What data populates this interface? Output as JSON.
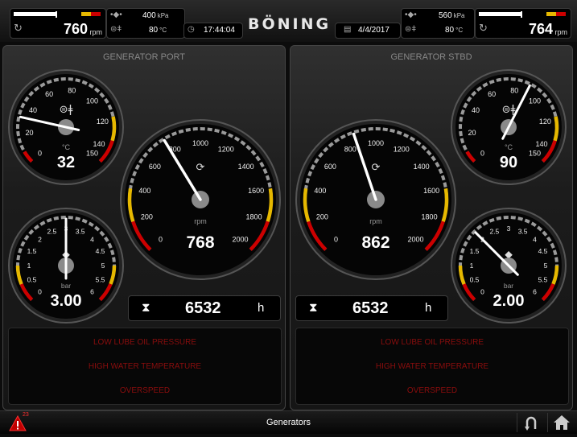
{
  "topbar": {
    "port": {
      "rpm_value": "760",
      "rpm_unit": "rpm",
      "pressure_value": "400",
      "pressure_unit": "kPa",
      "temp_value": "80",
      "temp_unit": "°C"
    },
    "time": "17:44:04",
    "logo": "BÖNING",
    "date": "4/4/2017",
    "stbd": {
      "rpm_value": "764",
      "rpm_unit": "rpm",
      "pressure_value": "560",
      "pressure_unit": "kPa",
      "temp_value": "80",
      "temp_unit": "°C"
    }
  },
  "panels": [
    {
      "title": "GENERATOR PORT",
      "temp_gauge": {
        "labels": [
          "0",
          "20",
          "40",
          "60",
          "80",
          "100",
          "120",
          "140",
          "150"
        ],
        "unit": "°C",
        "value": "32",
        "reading": 32
      },
      "pressure_gauge": {
        "labels": [
          "0",
          "0.5",
          "1",
          "1.5",
          "2",
          "2.5",
          "3",
          "3.5",
          "4",
          "4.5",
          "5",
          "5.5",
          "6"
        ],
        "unit": "bar",
        "value": "3.00",
        "reading": 3.0
      },
      "rpm_gauge": {
        "labels": [
          "0",
          "200",
          "400",
          "600",
          "800",
          "1000",
          "1200",
          "1400",
          "1600",
          "1800",
          "2000"
        ],
        "unit": "rpm",
        "value": "768",
        "reading": 768
      },
      "hours": {
        "value": "6532",
        "unit": "h"
      },
      "alarms": [
        "LOW LUBE OIL PRESSURE",
        "HIGH WATER TEMPERATURE",
        "OVERSPEED"
      ]
    },
    {
      "title": "GENERATOR STBD",
      "temp_gauge": {
        "labels": [
          "0",
          "20",
          "40",
          "60",
          "80",
          "100",
          "120",
          "140",
          "150"
        ],
        "unit": "°C",
        "value": "90",
        "reading": 90
      },
      "pressure_gauge": {
        "labels": [
          "0",
          "0.5",
          "1",
          "1.5",
          "2",
          "2.5",
          "3",
          "3.5",
          "4",
          "4.5",
          "5",
          "5.5",
          "6"
        ],
        "unit": "bar",
        "value": "2.00",
        "reading": 2.0
      },
      "rpm_gauge": {
        "labels": [
          "0",
          "200",
          "400",
          "600",
          "800",
          "1000",
          "1200",
          "1400",
          "1600",
          "1800",
          "2000"
        ],
        "unit": "rpm",
        "value": "862",
        "reading": 862
      },
      "hours": {
        "value": "6532",
        "unit": "h"
      },
      "alarms": [
        "LOW LUBE OIL PRESSURE",
        "HIGH WATER TEMPERATURE",
        "OVERSPEED"
      ]
    }
  ],
  "bottombar": {
    "title": "Generators",
    "alarm_count": "23"
  },
  "icons": {
    "alarm": "warning-triangle-icon",
    "back": "return-arrow-icon",
    "home": "home-icon",
    "hourglass": "hourglass-icon",
    "clock": "clock-icon",
    "calendar": "calendar-icon"
  },
  "colors": {
    "accent_red": "#cc0000",
    "accent_yellow": "#e6b800",
    "alarm_text": "#8a0d0d"
  }
}
